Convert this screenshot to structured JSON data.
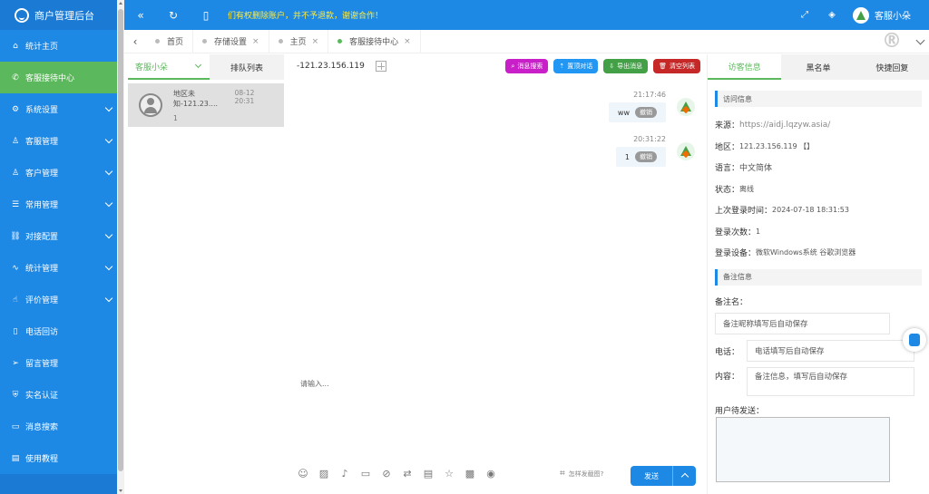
{
  "sidebar": {
    "title": "商户管理后台",
    "items": [
      {
        "label": "统计主页",
        "icon": "home-icon",
        "glyph": "⌂",
        "chevron": false
      },
      {
        "label": "客服接待中心",
        "icon": "service-icon",
        "glyph": "✆",
        "chevron": false
      },
      {
        "label": "系统设置",
        "icon": "gear-icon",
        "glyph": "⚙",
        "chevron": true
      },
      {
        "label": "客服管理",
        "icon": "user-icon",
        "glyph": "♙",
        "chevron": true
      },
      {
        "label": "客户管理",
        "icon": "customers-icon",
        "glyph": "♙",
        "chevron": true
      },
      {
        "label": "常用管理",
        "icon": "document-icon",
        "glyph": "☰",
        "chevron": true
      },
      {
        "label": "对接配置",
        "icon": "link-icon",
        "glyph": "⛓",
        "chevron": true
      },
      {
        "label": "统计管理",
        "icon": "chart-icon",
        "glyph": "∿",
        "chevron": true
      },
      {
        "label": "评价管理",
        "icon": "thumb-up-icon",
        "glyph": "☝",
        "chevron": true
      },
      {
        "label": "电话回访",
        "icon": "phone-icon",
        "glyph": "▯",
        "chevron": false
      },
      {
        "label": "留言管理",
        "icon": "send-icon",
        "glyph": "➢",
        "chevron": false
      },
      {
        "label": "实名认证",
        "icon": "shield-icon",
        "glyph": "⛨",
        "chevron": false
      },
      {
        "label": "消息搜索",
        "icon": "message-icon",
        "glyph": "▭",
        "chevron": false
      },
      {
        "label": "使用教程",
        "icon": "book-icon",
        "glyph": "▤",
        "chevron": false
      }
    ],
    "active_index": 1
  },
  "topbar": {
    "notice": "们有权删除账户，并不予退款，谢谢合作！",
    "username": "客服小朵",
    "icons": {
      "collapse": "«",
      "refresh": "↻",
      "mobile": "▯",
      "fullscreen": "⤢",
      "skin": "◈"
    }
  },
  "tabs": [
    {
      "label": "首页",
      "closable": false,
      "active": false
    },
    {
      "label": "存储设置",
      "closable": true,
      "active": false
    },
    {
      "label": "主页",
      "closable": true,
      "active": false
    },
    {
      "label": "客服接待中心",
      "closable": true,
      "active": true
    }
  ],
  "tab_close_glyph": "×",
  "left_panel": {
    "tab_active": "客服小朵",
    "tab_queue": "排队列表",
    "visitor": {
      "name": "地区未知-121.23....",
      "time": "08-12 20:31",
      "last_msg": "1"
    }
  },
  "chat": {
    "ip": "-121.23.156.119",
    "buttons": [
      {
        "label": "消息搜索",
        "color": "#c81fc8",
        "glyph": "⌕"
      },
      {
        "label": "置顶对话",
        "color": "#2196f3",
        "glyph": "⇡"
      },
      {
        "label": "导出消息",
        "color": "#43a047",
        "glyph": "⇩"
      },
      {
        "label": "清空列表",
        "color": "#c62828",
        "glyph": "🗑"
      }
    ],
    "messages": [
      {
        "time": "21:17:46",
        "text": "ww",
        "revoke": "撤销"
      },
      {
        "time": "20:31:22",
        "text": "1",
        "revoke": "撤销"
      }
    ],
    "input_placeholder": "请输入...",
    "screenshot_hint": "怎样发截图?",
    "send_label": "发送",
    "toolbar_glyphs": [
      "☺",
      "▨",
      "♪",
      "▭",
      "⊘",
      "⇄",
      "▤",
      "☆",
      "▩",
      "◉"
    ]
  },
  "right_panel": {
    "tabs": [
      "访客信息",
      "黑名单",
      "快捷回复"
    ],
    "visit_section": "访问信息",
    "fields": [
      {
        "k": "来源：",
        "v": "https://aidj.lqzyw.asia/",
        "cls": "url"
      },
      {
        "k": "地区：",
        "v": "121.23.156.119 【】",
        "cls": ""
      },
      {
        "k": "语言：",
        "v": "中文简体",
        "cls": "big"
      },
      {
        "k": "状态：",
        "v": "离线",
        "cls": ""
      },
      {
        "k": "上次登录时间：",
        "v": "2024-07-18 18:31:53",
        "cls": ""
      },
      {
        "k": "登录次数：",
        "v": "1",
        "cls": ""
      },
      {
        "k": "登录设备：",
        "v": "微软Windows系统 谷歌浏览器",
        "cls": ""
      }
    ],
    "remark_section": "备注信息",
    "remark_name_label": "备注名：",
    "remark_name_placeholder": "备注昵称填写后自动保存",
    "phone_label": "电话：",
    "phone_placeholder": "电话填写后自动保存",
    "content_label": "内容：",
    "content_placeholder": "备注信息，填写后自动保存",
    "pending_label": "用户待发送："
  }
}
